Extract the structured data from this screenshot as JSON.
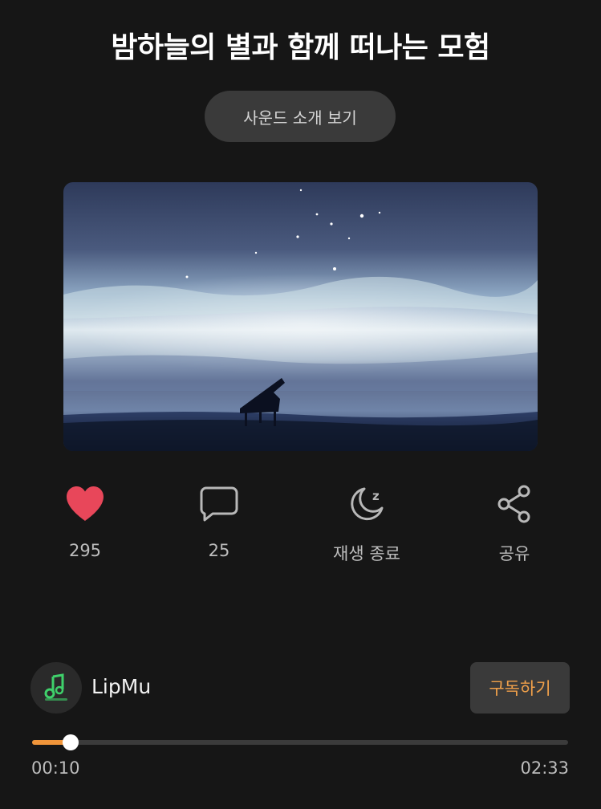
{
  "header": {
    "title": "밤하늘의 별과 함께 떠나는 모험",
    "intro_button_label": "사운드 소개 보기"
  },
  "actions": [
    {
      "name": "like",
      "icon": "heart-icon",
      "label": "295",
      "color": "#e8475a"
    },
    {
      "name": "comment",
      "icon": "comment-icon",
      "label": "25"
    },
    {
      "name": "sleep-timer",
      "icon": "moon-icon",
      "label": "재생 종료"
    },
    {
      "name": "share",
      "icon": "share-icon",
      "label": "공유"
    }
  ],
  "creator": {
    "name": "LipMu",
    "subscribe_label": "구독하기",
    "avatar_icon": "music-note-logo"
  },
  "player": {
    "current_time": "00:10",
    "total_time": "02:33",
    "progress_fraction": 0.0725,
    "accent_color": "#f0953a"
  }
}
